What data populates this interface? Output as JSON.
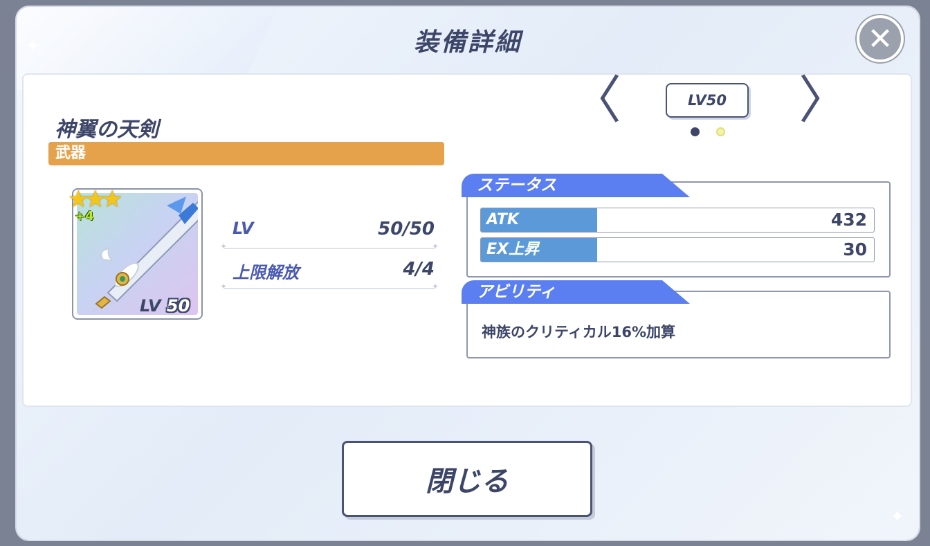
{
  "dialog": {
    "title": "装備詳細",
    "close_icon": "close-icon"
  },
  "nav": {
    "level_label": "LV50",
    "page_dots": 2,
    "active_dot": 0,
    "prev_icon": "chevron-left-icon",
    "next_icon": "chevron-right-icon",
    "prev_glyph": "〈",
    "next_glyph": "〉"
  },
  "equipment": {
    "name": "神翼の天剣",
    "category": "武器",
    "rarity_stars": 3,
    "star_glyphs": "★★★",
    "refine": "+4",
    "icon_level_prefix": "LV",
    "icon_level_value": "50"
  },
  "stats": [
    {
      "label": "LV",
      "value": "50/50"
    },
    {
      "label": "上限解放",
      "value": "4/4"
    }
  ],
  "status_section": {
    "header": "ステータス",
    "rows": [
      {
        "key": "ATK",
        "value": "432"
      },
      {
        "key": "EX上昇",
        "value": "30"
      }
    ]
  },
  "ability_section": {
    "header": "アビリティ",
    "text": "神族のクリティカル16%加算"
  },
  "footer": {
    "close_button_label": "閉じる"
  },
  "colors": {
    "accent_blue": "#5b7ff0",
    "category_orange": "#e6a24b",
    "text_navy": "#3d4668",
    "dot_active": "#3d4668",
    "dot_inactive": "#f4f3a8"
  }
}
